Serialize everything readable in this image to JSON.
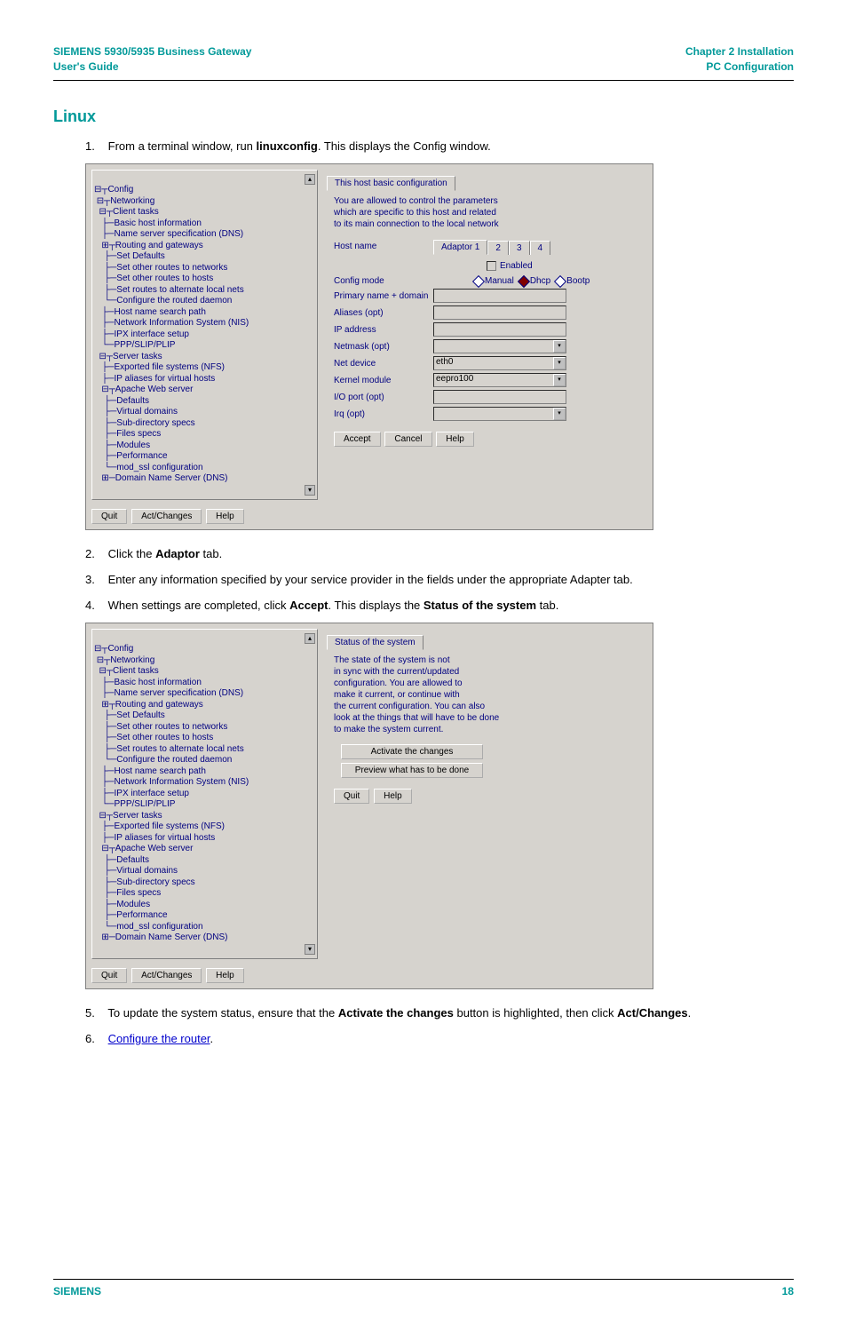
{
  "header": {
    "left_line1": "SIEMENS 5930/5935 Business Gateway",
    "left_line2": "User's Guide",
    "right_line1": "Chapter 2  Installation",
    "right_line2": "PC Configuration"
  },
  "section_title": "Linux",
  "steps": {
    "s1_pre": "From a terminal window, run ",
    "s1_bold": "linuxconfig",
    "s1_post": ". This displays the Config window.",
    "s2_pre": "Click the ",
    "s2_bold": "Adaptor",
    "s2_post": " tab.",
    "s3": "Enter any information specified by your service provider in the fields under the appropriate Adapter tab.",
    "s4_pre": "When settings are completed, click ",
    "s4_bold1": "Accept",
    "s4_mid": ". This displays the ",
    "s4_bold2": "Status of the system",
    "s4_post": " tab.",
    "s5_pre": "To update the system status, ensure that the ",
    "s5_bold1": "Activate the changes",
    "s5_mid": " button is highlighted, then click ",
    "s5_bold2": "Act/Changes",
    "s5_post": ".",
    "s6_link": "Configure the router",
    "s6_post": "."
  },
  "tree_items": [
    "⊟┬Config",
    " ⊟┬Networking",
    "  ⊟┬Client tasks",
    "   ├─Basic host information",
    "   ├─Name server specification (DNS)",
    "   ⊞┬Routing and gateways",
    "    ├─Set Defaults",
    "    ├─Set other routes to networks",
    "    ├─Set other routes to hosts",
    "    ├─Set routes to alternate local nets",
    "    └─Configure the routed daemon",
    "   ├─Host name search path",
    "   ├─Network Information System (NIS)",
    "   ├─IPX interface setup",
    "   └─PPP/SLIP/PLIP",
    "  ⊟┬Server tasks",
    "   ├─Exported file systems (NFS)",
    "   ├─IP aliases for virtual hosts",
    "   ⊟┬Apache Web server",
    "    ├─Defaults",
    "    ├─Virtual domains",
    "    ├─Sub-directory specs",
    "    ├─Files specs",
    "    ├─Modules",
    "    ├─Performance",
    "    └─mod_ssl configuration",
    "   ⊞─Domain Name Server (DNS)"
  ],
  "shot1": {
    "tab_main": "This host basic configuration",
    "intro1": "You are allowed to control the parameters",
    "intro2": "which are specific to this host and related",
    "intro3": "to its main connection to the local network",
    "hostname_label": "Host name",
    "adaptor_tabs": [
      "Adaptor 1",
      "2",
      "3",
      "4"
    ],
    "enabled_label": "Enabled",
    "configmode_label": "Config mode",
    "mode_manual": "Manual",
    "mode_dhcp": "Dhcp",
    "mode_bootp": "Bootp",
    "fields": {
      "primary": "Primary name + domain",
      "aliases": "Aliases (opt)",
      "ip": "IP address",
      "netmask": "Netmask (opt)",
      "netdev": "Net device",
      "netdev_val": "eth0",
      "kernel": "Kernel module",
      "kernel_val": "eepro100",
      "ioport": "I/O port (opt)",
      "irq": "Irq (opt)"
    },
    "btn_accept": "Accept",
    "btn_cancel": "Cancel",
    "btn_help": "Help"
  },
  "shot2": {
    "tab_main": "Status of the system",
    "intro": [
      "The state of the system is not",
      "in sync with the current/updated",
      "configuration. You are allowed to",
      "make it current, or continue with",
      "the current configuration. You can also",
      "look at the things that will have to be done",
      "to make the system current."
    ],
    "btn_activate": "Activate the changes",
    "btn_preview": "Preview what has to be done",
    "btn_quit": "Quit",
    "btn_help": "Help"
  },
  "bottom_buttons": {
    "quit": "Quit",
    "act": "Act/Changes",
    "help": "Help"
  },
  "footer": {
    "left": "SIEMENS",
    "right": "18"
  }
}
